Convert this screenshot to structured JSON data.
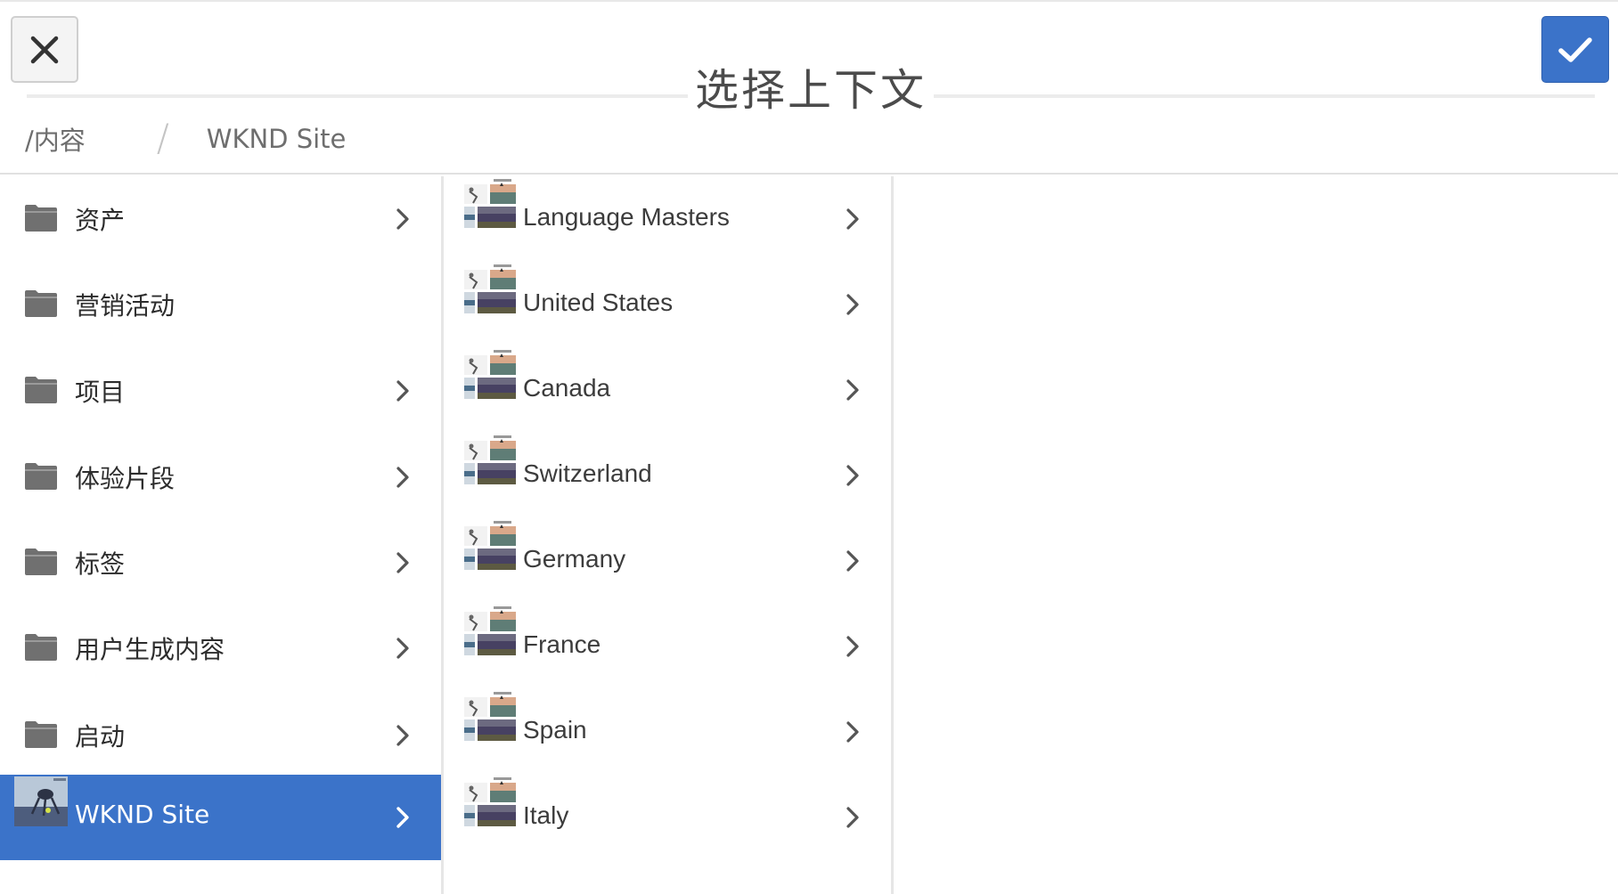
{
  "dialog": {
    "title": "选择上下文",
    "close_icon": "close-icon",
    "confirm_icon": "checkmark-icon",
    "accent_color": "#3b73c9"
  },
  "breadcrumb": {
    "root": "/内容",
    "separator": "/",
    "current": "WKND Site"
  },
  "column1": {
    "items": [
      {
        "label": "资产",
        "icon": "folder-icon",
        "has_children": true
      },
      {
        "label": "营销活动",
        "icon": "folder-icon",
        "has_children": false
      },
      {
        "label": "项目",
        "icon": "folder-icon",
        "has_children": true
      },
      {
        "label": "体验片段",
        "icon": "folder-icon",
        "has_children": true
      },
      {
        "label": "标签",
        "icon": "folder-icon",
        "has_children": true
      },
      {
        "label": "用户生成内容",
        "icon": "folder-icon",
        "has_children": true
      },
      {
        "label": "启动",
        "icon": "folder-icon",
        "has_children": true
      },
      {
        "label": "WKND Site",
        "icon": "site-thumbnail",
        "has_children": true,
        "selected": true
      }
    ]
  },
  "column2": {
    "items": [
      {
        "label": "Language Masters",
        "icon": "page-thumbnail",
        "has_children": true
      },
      {
        "label": "United States",
        "icon": "page-thumbnail",
        "has_children": true
      },
      {
        "label": "Canada",
        "icon": "page-thumbnail",
        "has_children": true
      },
      {
        "label": "Switzerland",
        "icon": "page-thumbnail",
        "has_children": true
      },
      {
        "label": "Germany",
        "icon": "page-thumbnail",
        "has_children": true
      },
      {
        "label": "France",
        "icon": "page-thumbnail",
        "has_children": true
      },
      {
        "label": "Spain",
        "icon": "page-thumbnail",
        "has_children": true
      },
      {
        "label": "Italy",
        "icon": "page-thumbnail",
        "has_children": true
      }
    ]
  }
}
